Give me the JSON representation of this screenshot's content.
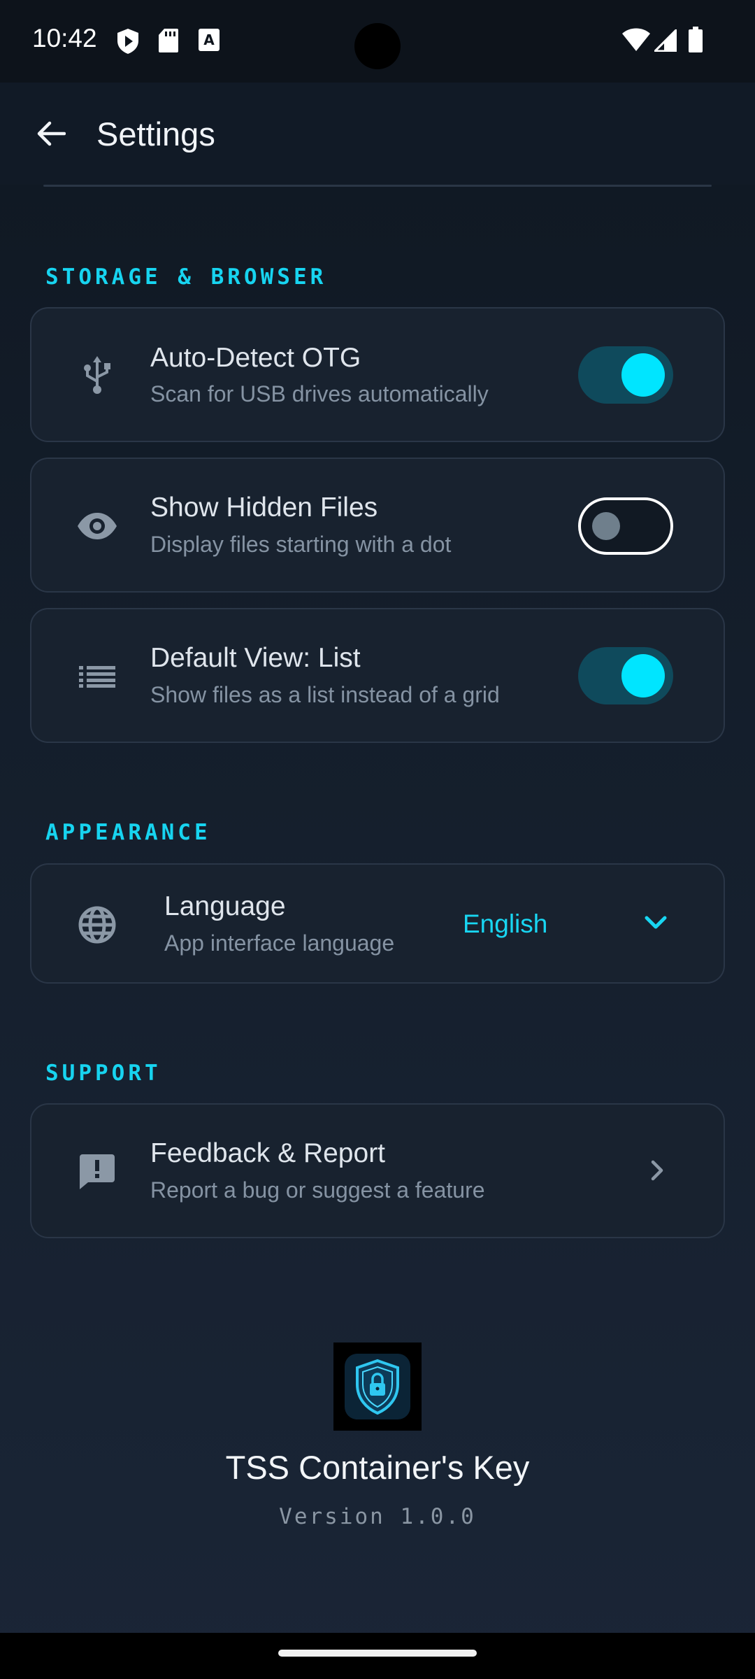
{
  "status_bar": {
    "time": "10:42",
    "left_icons": [
      "shield-play-icon",
      "sd-card-icon",
      "keyboard-a-icon"
    ],
    "right_icons": [
      "wifi-icon",
      "signal-icon",
      "battery-icon"
    ]
  },
  "header": {
    "title": "Settings",
    "back_icon": "arrow-back-icon"
  },
  "sections": {
    "storage": {
      "label": "STORAGE & BROWSER",
      "items": [
        {
          "title": "Auto-Detect OTG",
          "subtitle": "Scan for USB drives automatically",
          "icon": "usb-icon",
          "enabled": true
        },
        {
          "title": "Show Hidden Files",
          "subtitle": "Display files starting with a dot",
          "icon": "eye-icon",
          "enabled": false
        },
        {
          "title": "Default View: List",
          "subtitle": "Show files as a list instead of a grid",
          "icon": "list-icon",
          "enabled": true
        }
      ]
    },
    "appearance": {
      "label": "APPEARANCE",
      "language": {
        "title": "Language",
        "subtitle": "App interface language",
        "value": "English",
        "icon": "globe-icon"
      }
    },
    "support": {
      "label": "SUPPORT",
      "feedback": {
        "title": "Feedback & Report",
        "subtitle": "Report a bug or suggest a feature",
        "icon": "feedback-icon"
      }
    }
  },
  "footer": {
    "app_name": "TSS Container's Key",
    "version": "Version 1.0.0"
  },
  "colors": {
    "accent": "#00e5ff",
    "section_label": "#17d4f0",
    "card_bg": "#18222f",
    "card_border": "#2a3647",
    "background": "#141e2b"
  }
}
